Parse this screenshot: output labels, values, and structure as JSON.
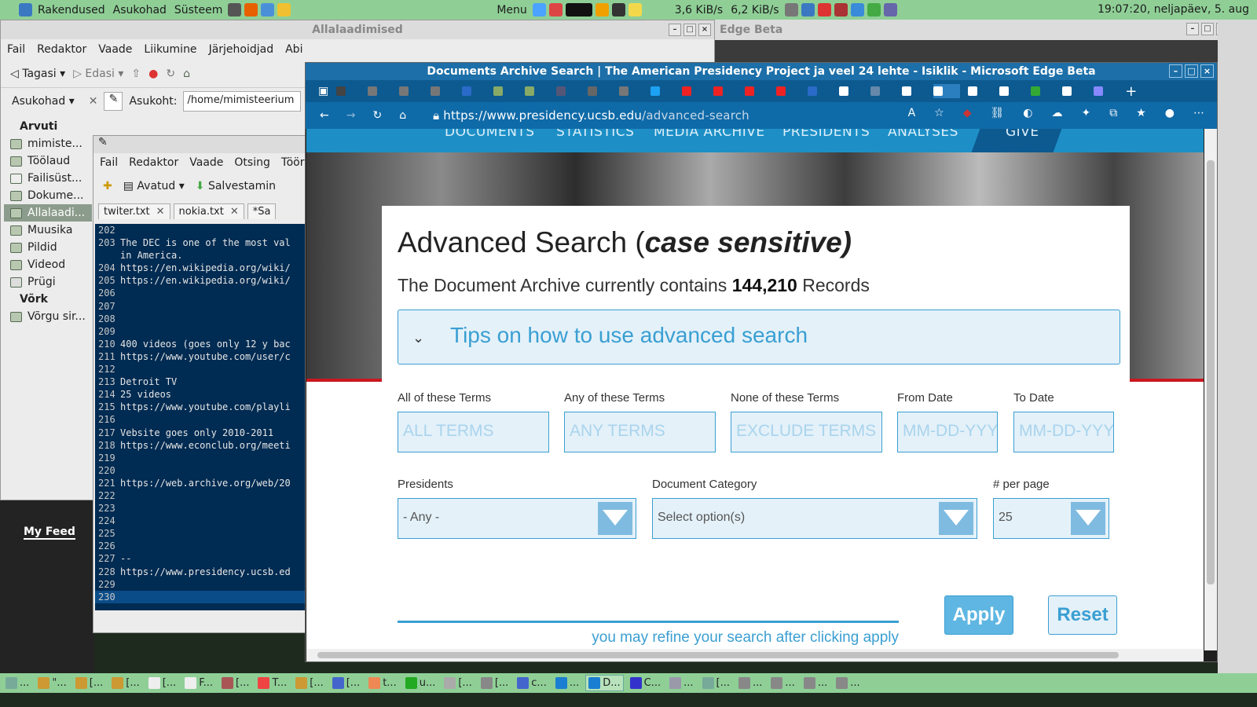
{
  "top_panel": {
    "menus": [
      "Rakendused",
      "Asukohad",
      "Süsteem"
    ],
    "menu_label": "Menu",
    "network_speed": "3,6 KiB/s",
    "network_speed_up": "6,2 KiB/s",
    "clock": "19:07:20, neljapäev,  5. aug"
  },
  "file_manager": {
    "title": "Allalaadimised",
    "menu": [
      "Fail",
      "Redaktor",
      "Vaade",
      "Liikumine",
      "Järjehoidjad",
      "Abi"
    ],
    "back_label": "Tagasi",
    "forward_label": "Edasi",
    "places_label": "Asukohad",
    "location_label": "Asukoht:",
    "location_value": "/home/mimisteerium",
    "section_computer": "Arvuti",
    "section_network": "Võrk",
    "sidebar_items": [
      "mimiste...",
      "Töölaud",
      "Failisüst...",
      "Dokume...",
      "Allalaadi...",
      "Muusika",
      "Pildid",
      "Videod",
      "Prügi"
    ],
    "network_items": [
      "Võrgu sir..."
    ]
  },
  "myfeed": {
    "label": "My Feed"
  },
  "editor": {
    "menu": [
      "Fail",
      "Redaktor",
      "Vaade",
      "Otsing",
      "Tööriist"
    ],
    "open_label": "Avatud",
    "save_label": "Salvestamin",
    "tabs": [
      "twiter.txt",
      "nokia.txt",
      "*Sa"
    ],
    "lines": [
      {
        "n": "202",
        "t": ""
      },
      {
        "n": "203",
        "t": "The DEC is one of the most val"
      },
      {
        "n": "",
        "t": "in America."
      },
      {
        "n": "204",
        "t": "https://en.wikipedia.org/wiki/"
      },
      {
        "n": "205",
        "t": "https://en.wikipedia.org/wiki/"
      },
      {
        "n": "206",
        "t": ""
      },
      {
        "n": "207",
        "t": ""
      },
      {
        "n": "208",
        "t": ""
      },
      {
        "n": "209",
        "t": ""
      },
      {
        "n": "210",
        "t": "400 videos (goes only 12 y bac"
      },
      {
        "n": "211",
        "t": "https://www.youtube.com/user/c"
      },
      {
        "n": "212",
        "t": ""
      },
      {
        "n": "213",
        "t": "Detroit TV"
      },
      {
        "n": "214",
        "t": "25 videos"
      },
      {
        "n": "215",
        "t": "https://www.youtube.com/playli"
      },
      {
        "n": "216",
        "t": ""
      },
      {
        "n": "217",
        "t": "Vebsite goes only 2010-2011"
      },
      {
        "n": "218",
        "t": "https://www.econclub.org/meeti"
      },
      {
        "n": "219",
        "t": ""
      },
      {
        "n": "220",
        "t": ""
      },
      {
        "n": "221",
        "t": "https://web.archive.org/web/20"
      },
      {
        "n": "222",
        "t": ""
      },
      {
        "n": "223",
        "t": ""
      },
      {
        "n": "224",
        "t": ""
      },
      {
        "n": "225",
        "t": ""
      },
      {
        "n": "226",
        "t": ""
      },
      {
        "n": "227",
        "t": "--"
      },
      {
        "n": "228",
        "t": "https://www.presidency.ucsb.ed"
      },
      {
        "n": "229",
        "t": ""
      },
      {
        "n": "230",
        "t": ""
      }
    ]
  },
  "edge_bg": {
    "title": "Edge Beta"
  },
  "browser": {
    "title": "Documents Archive Search | The American Presidency Project ja veel 24 lehte - Isiklik - Microsoft Edge Beta",
    "url_host": "https://www.presidency.ucsb.edu",
    "url_path": "/advanced-search",
    "site_nav": [
      "DOCUMENTS",
      "STATISTICS",
      "MEDIA ARCHIVE",
      "PRESIDENTS",
      "ANALYSES",
      "GIVE"
    ],
    "heading": "Advanced Search (",
    "heading_em": "case sensitive)",
    "count_prefix": "The Document Archive currently contains ",
    "count_value": "144,210",
    "count_suffix": " Records",
    "tips_label": "Tips on how to use advanced search",
    "fields": {
      "all_label": "All of these Terms",
      "all_placeholder": "ALL TERMS",
      "any_label": "Any of these Terms",
      "any_placeholder": "ANY TERMS",
      "none_label": "None of these Terms",
      "none_placeholder": "EXCLUDE TERMS",
      "from_label": "From Date",
      "from_placeholder": "MM-DD-YYY",
      "to_label": "To Date",
      "to_placeholder": "MM-DD-YYY",
      "presidents_label": "Presidents",
      "presidents_value": "- Any -",
      "category_label": "Document Category",
      "category_value": "Select option(s)",
      "perpage_label": "# per page",
      "perpage_value": "25"
    },
    "apply_label": "Apply",
    "reset_label": "Reset",
    "refine_text": "you may refine your search after clicking apply"
  },
  "taskbar": {
    "items": [
      "...",
      "\"...",
      "[...",
      "[...",
      "[...",
      "F...",
      "[...",
      "T...",
      "[...",
      "[...",
      "t...",
      "u...",
      "[...",
      "[...",
      "c...",
      "...",
      "D...",
      "C...",
      "...",
      "[...",
      "...",
      "...",
      "...",
      "..."
    ]
  }
}
